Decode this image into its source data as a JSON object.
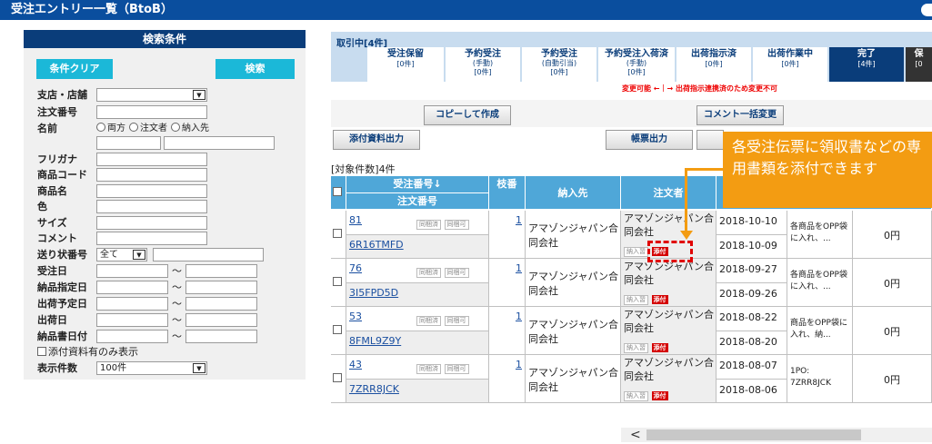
{
  "title": "受注エントリー一覧（BtoB）",
  "search": {
    "header": "検索条件",
    "clear_label": "条件クリア",
    "search_label": "検索",
    "fields": {
      "store": "支店・店舗",
      "order_no": "注文番号",
      "name": "名前",
      "furigana": "フリガナ",
      "product_code": "商品コード",
      "product_name": "商品名",
      "color": "色",
      "size": "サイズ",
      "comment": "コメント",
      "invoice_status": "送り状番号",
      "order_date": "受注日",
      "delivery_date": "納品指定日",
      "ship_plan_date": "出荷予定日",
      "ship_date": "出荷日",
      "invoice_date": "納品書日付",
      "display_count": "表示件数"
    },
    "name_radios": [
      "両方",
      "注文者",
      "納入先"
    ],
    "invoice_status_value": "全て",
    "tilde": "〜",
    "attachment_only": "添付資料有のみ表示",
    "display_count_value": "100件"
  },
  "status": {
    "label": "取引中[4件]",
    "tabs": [
      {
        "label": "受注保留",
        "sub": "",
        "count": "[0件]"
      },
      {
        "label": "予約受注",
        "sub": "(手動)",
        "count": "[0件]"
      },
      {
        "label": "予約受注",
        "sub": "(自動引当)",
        "count": "[0件]"
      },
      {
        "label": "予約受注入荷済",
        "sub": "(手動)",
        "count": "[0件]"
      },
      {
        "label": "出荷指示済",
        "sub": "",
        "count": "[0件]"
      },
      {
        "label": "出荷作業中",
        "sub": "",
        "count": "[0件]"
      },
      {
        "label": "完了",
        "sub": "",
        "count": "[4件]"
      },
      {
        "label": "保",
        "sub": "",
        "count": "[0"
      }
    ],
    "change_note": "変更可能 ←｜→ 出荷指示連携済のため変更不可"
  },
  "buttons": {
    "copy_create": "コピーして作成",
    "comment_bulk": "コメント一括変更",
    "attach_output": "添付資料出力",
    "slip_output": "帳票出力"
  },
  "count_label": "[対象件数]4件",
  "table": {
    "headers": {
      "order_no": "受注番号↓",
      "order_number": "注文番号",
      "branch": "枝番",
      "delivery": "納入先",
      "orderer": "注文者"
    },
    "badges": {
      "merge_done": "同梱済",
      "merge_ok": "同梱可",
      "delivery": "納入習",
      "attach": "添付"
    },
    "rows": [
      {
        "order_no": "81",
        "order_number": "6R16TMFD",
        "branch": "1",
        "delivery": "アマゾンジャパン合同会社",
        "orderer": "アマゾンジャパン合同会社",
        "date1": "2018-10-10",
        "date2": "2018-10-09",
        "note": "各商品をOPP袋に入れ、...",
        "amount": "0円"
      },
      {
        "order_no": "76",
        "order_number": "3I5FPD5D",
        "branch": "1",
        "delivery": "アマゾンジャパン合同会社",
        "orderer": "アマゾンジャパン合同会社",
        "date1": "2018-09-27",
        "date2": "2018-09-26",
        "note": "各商品をOPP袋に入れ、...",
        "amount": "0円"
      },
      {
        "order_no": "53",
        "order_number": "8FML9Z9Y",
        "branch": "1",
        "delivery": "アマゾンジャパン合同会社",
        "orderer": "アマゾンジャパン合同会社",
        "date1": "2018-08-22",
        "date2": "2018-08-20",
        "note": "商品をOPP袋に入れ、納...",
        "amount": "0円"
      },
      {
        "order_no": "43",
        "order_number": "7ZRR8JCK",
        "branch": "1",
        "delivery": "アマゾンジャパン合同会社",
        "orderer": "アマゾンジャパン合同会社",
        "date1": "2018-08-07",
        "date2": "2018-08-06",
        "note": "1PO: 7ZRR8JCK",
        "amount": "0円"
      }
    ]
  },
  "callout": "各受注伝票に領収書などの専用書類を添付できます",
  "scroll_left": "<"
}
